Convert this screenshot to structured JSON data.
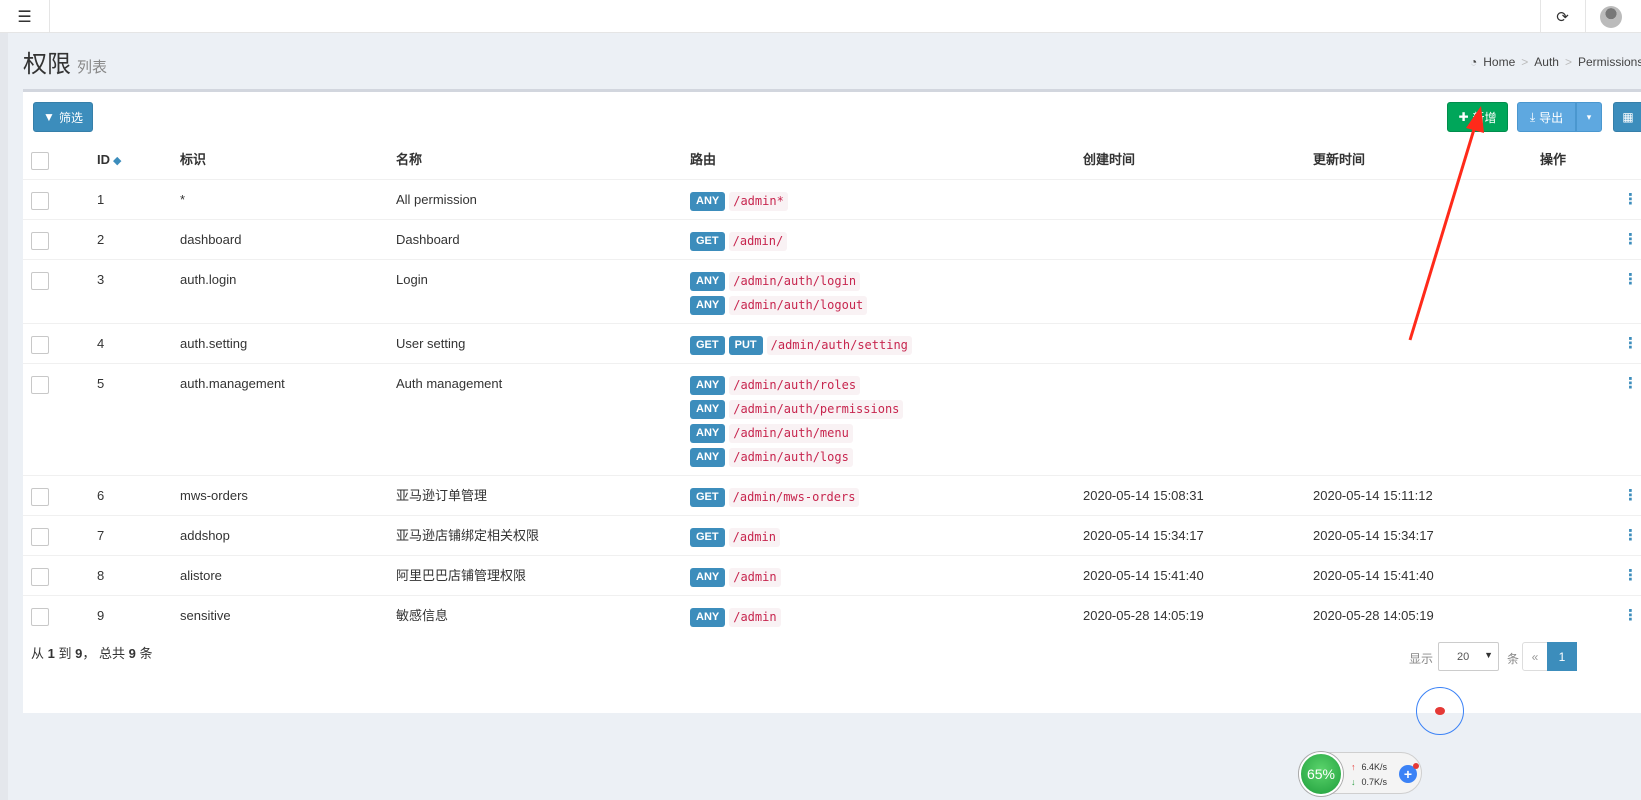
{
  "navbar": {
    "toggle_icon": "menu-icon",
    "refresh_icon": "refresh-icon",
    "avatar_icon": "user-avatar"
  },
  "header": {
    "title": "权限",
    "subtitle": "列表",
    "breadcrumb": [
      "Home",
      "Auth",
      "Permissions"
    ],
    "breadcrumb_sep": ">"
  },
  "toolbar": {
    "filter_label": "筛选",
    "new_label": "新增",
    "export_label": "导出",
    "export_caret": "▾",
    "columns_icon": "▦"
  },
  "table": {
    "headers": {
      "id": "ID",
      "slug": "标识",
      "name": "名称",
      "path": "路由",
      "created": "创建时间",
      "updated": "更新时间",
      "action": "操作"
    },
    "sort_icon": "◆",
    "action_icon": "⋮",
    "rows": [
      {
        "id": "1",
        "slug": "*",
        "name": "All permission",
        "routes": [
          {
            "methods": [
              "ANY"
            ],
            "path": "/admin*"
          }
        ],
        "created": "",
        "updated": ""
      },
      {
        "id": "2",
        "slug": "dashboard",
        "name": "Dashboard",
        "routes": [
          {
            "methods": [
              "GET"
            ],
            "path": "/admin/"
          }
        ],
        "created": "",
        "updated": ""
      },
      {
        "id": "3",
        "slug": "auth.login",
        "name": "Login",
        "routes": [
          {
            "methods": [
              "ANY"
            ],
            "path": "/admin/auth/login"
          },
          {
            "methods": [
              "ANY"
            ],
            "path": "/admin/auth/logout"
          }
        ],
        "created": "",
        "updated": ""
      },
      {
        "id": "4",
        "slug": "auth.setting",
        "name": "User setting",
        "routes": [
          {
            "methods": [
              "GET",
              "PUT"
            ],
            "path": "/admin/auth/setting"
          }
        ],
        "created": "",
        "updated": ""
      },
      {
        "id": "5",
        "slug": "auth.management",
        "name": "Auth management",
        "routes": [
          {
            "methods": [
              "ANY"
            ],
            "path": "/admin/auth/roles"
          },
          {
            "methods": [
              "ANY"
            ],
            "path": "/admin/auth/permissions"
          },
          {
            "methods": [
              "ANY"
            ],
            "path": "/admin/auth/menu"
          },
          {
            "methods": [
              "ANY"
            ],
            "path": "/admin/auth/logs"
          }
        ],
        "created": "",
        "updated": ""
      },
      {
        "id": "6",
        "slug": "mws-orders",
        "name": "亚马逊订单管理",
        "routes": [
          {
            "methods": [
              "GET"
            ],
            "path": "/admin/mws-orders"
          }
        ],
        "created": "2020-05-14 15:08:31",
        "updated": "2020-05-14 15:11:12"
      },
      {
        "id": "7",
        "slug": "addshop",
        "name": "亚马逊店铺绑定相关权限",
        "routes": [
          {
            "methods": [
              "GET"
            ],
            "path": "/admin"
          }
        ],
        "created": "2020-05-14 15:34:17",
        "updated": "2020-05-14 15:34:17"
      },
      {
        "id": "8",
        "slug": "alistore",
        "name": "阿里巴巴店铺管理权限",
        "routes": [
          {
            "methods": [
              "ANY"
            ],
            "path": "/admin"
          }
        ],
        "created": "2020-05-14 15:41:40",
        "updated": "2020-05-14 15:41:40"
      },
      {
        "id": "9",
        "slug": "sensitive",
        "name": "敏感信息",
        "routes": [
          {
            "methods": [
              "ANY"
            ],
            "path": "/admin"
          }
        ],
        "created": "2020-05-28 14:05:19",
        "updated": "2020-05-28 14:05:19"
      }
    ]
  },
  "footer": {
    "from_prefix": "从",
    "from": "1",
    "to_prefix": "到",
    "to": "9",
    "total_prefix": "， 总共",
    "total": "9",
    "total_suffix": "条",
    "per_page_label": "显示",
    "per_page_value": "20",
    "per_page_unit": "条",
    "prev": "«",
    "current_page": "1"
  },
  "net_widget": {
    "percent": "65%",
    "upload": "6.4K/s",
    "download": "0.7K/s",
    "up_arrow": "↑",
    "down_arrow": "↓",
    "plus": "+"
  },
  "colors": {
    "primary": "#3c8dbc",
    "success": "#00a65a",
    "route_text": "#c7254e",
    "annotation_arrow": "#ff2a1a"
  }
}
